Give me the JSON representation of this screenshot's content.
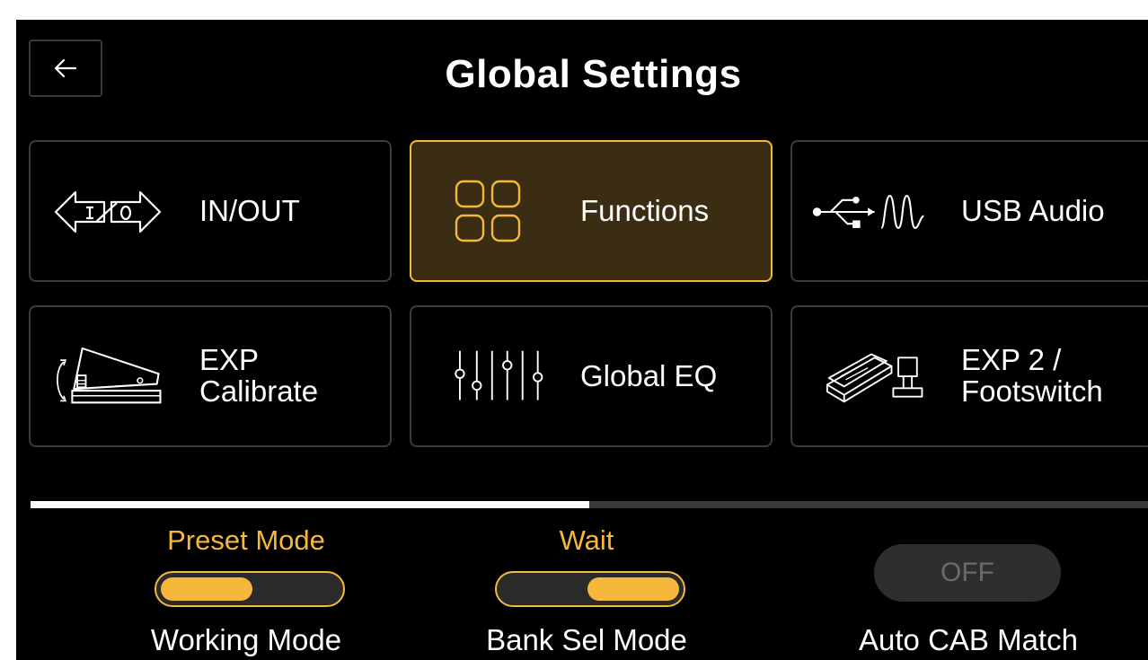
{
  "header": {
    "title": "Global Settings"
  },
  "tiles": [
    {
      "label": "IN/OUT",
      "icon": "io-arrows-icon"
    },
    {
      "label": "Functions",
      "icon": "four-squares-icon",
      "active": true
    },
    {
      "label": "USB Audio",
      "icon": "usb-waveform-icon"
    },
    {
      "label": "EXP\nCalibrate",
      "icon": "expression-pedal-icon"
    },
    {
      "label": "Global EQ",
      "icon": "eq-sliders-icon"
    },
    {
      "label": "EXP 2 /\nFootswitch",
      "icon": "pedal-footswitch-icon"
    }
  ],
  "pagination": {
    "progress": 0.5
  },
  "settings": {
    "working_mode": {
      "value": "Preset Mode",
      "label": "Working Mode",
      "toggle": "left"
    },
    "bank_sel_mode": {
      "value": "Wait",
      "label": "Bank Sel Mode",
      "toggle": "right"
    },
    "auto_cab_match": {
      "value": "OFF",
      "label": "Auto CAB Match"
    }
  },
  "colors": {
    "accent": "#f6b83c",
    "active_tile_bg": "#3a2d14",
    "background": "#000000",
    "border": "#3c3c3c"
  }
}
